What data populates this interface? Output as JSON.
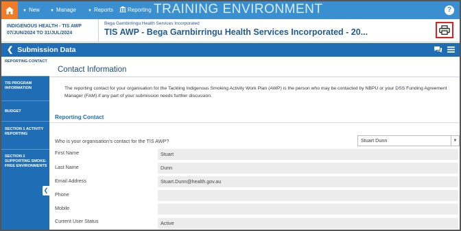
{
  "nav": {
    "new": "New",
    "manage": "Manage",
    "reports": "Reports",
    "reporting": "Reporting",
    "watermark": "TRAINING ENVIRONMENT",
    "help": "?"
  },
  "header": {
    "program_line": "Indigenous Health - TIS AWP",
    "period_line": "07/Jun/2024 to 31/Jul/2024",
    "org_small": "Bega Garnbirringu Health Services Incorporated",
    "title": "TIS AWP - Bega Garnbirringu Health Services Incorporated - 20..."
  },
  "section": {
    "title": "Submission Data"
  },
  "sidebar": {
    "items": [
      {
        "label": "Reporting Contact"
      },
      {
        "label": "TIS Program Information"
      },
      {
        "label": "Budget"
      },
      {
        "label": "Section 1 Activity Reporting"
      },
      {
        "label": "Section 2 Supporting Smoke-Free Environments"
      }
    ]
  },
  "content": {
    "title": "Contact Information",
    "description": "The reporting contact for your organisation for the Tackling Indigenous Smoking Activity Work Plan (AWP) is the person who may be contacted by NBPU or your DSS Funding Agreement Manager (FAM) if any part of your submission needs further discussion.",
    "reporting_contact_title": "Reporting Contact",
    "question": "Who is your organisation's contact for the TIS AWP?",
    "selected_contact": "Stuart Dunn",
    "fields": [
      {
        "label": "First Name",
        "value": "Stuart"
      },
      {
        "label": "Last Name",
        "value": "Dunn"
      },
      {
        "label": "Email Address",
        "value": "Stuart.Dunn@health.gov.au"
      },
      {
        "label": "Phone",
        "value": ""
      },
      {
        "label": "Mobile",
        "value": ""
      },
      {
        "label": "Current User Status",
        "value": "Active"
      }
    ]
  },
  "colors": {
    "nav_blue": "#3a8fd0",
    "section_blue": "#1f6db5",
    "home_orange": "#f07c2a",
    "print_highlight": "#e0201f"
  }
}
